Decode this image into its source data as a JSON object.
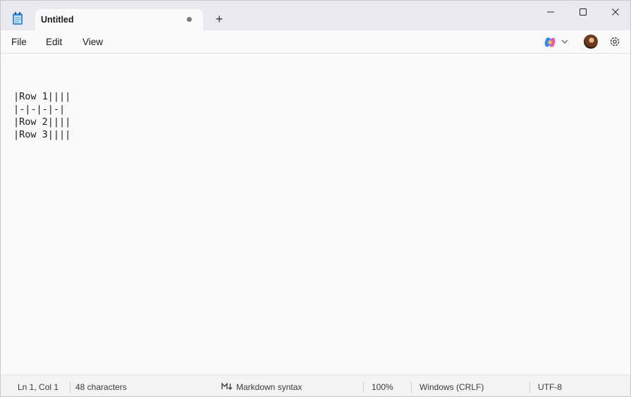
{
  "tab": {
    "title": "Untitled"
  },
  "titlebar": {
    "new_tab": "+"
  },
  "menu": {
    "file": "File",
    "edit": "Edit",
    "view": "View"
  },
  "editor": {
    "lines": [
      "|Row 1||||",
      "|-|-|-|-|",
      "|Row 2||||",
      "|Row 3||||"
    ]
  },
  "status": {
    "position": "Ln 1, Col 1",
    "characters": "48 characters",
    "markdown": "Markdown syntax",
    "zoom": "100%",
    "line_ending": "Windows (CRLF)",
    "encoding": "UTF-8"
  }
}
